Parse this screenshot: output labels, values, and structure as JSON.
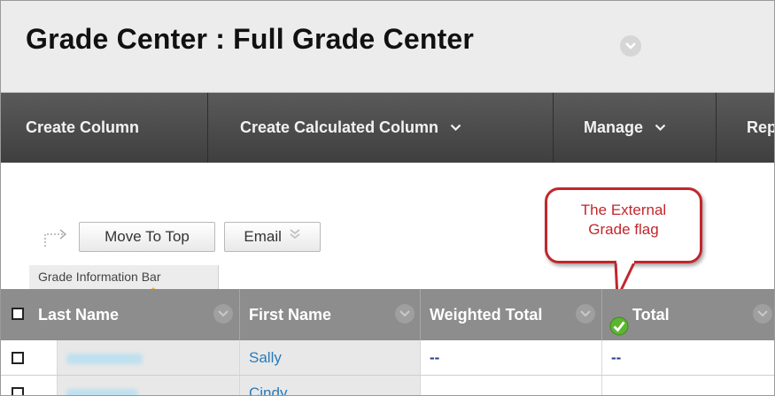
{
  "page": {
    "title": "Grade Center : Full Grade Center"
  },
  "toolbar": {
    "create_column": "Create Column",
    "create_calculated_column": "Create Calculated Column",
    "manage": "Manage",
    "reports_partial": "Rep"
  },
  "actions": {
    "move_to_top": "Move To Top",
    "email": "Email"
  },
  "info_bar": {
    "label": "Grade Information Bar"
  },
  "callout": {
    "line1": "The External",
    "line2": "Grade flag"
  },
  "grid": {
    "columns": [
      "Last Name",
      "First Name",
      "Weighted Total",
      "Total"
    ],
    "rows": [
      {
        "last_name": "",
        "first_name": "Sally",
        "weighted_total": "--",
        "total": "--"
      },
      {
        "last_name": "",
        "first_name": "Cindy",
        "weighted_total": "",
        "total": ""
      }
    ]
  },
  "colors": {
    "toolbar_bg": "#4a4a4a",
    "header_bg": "#8d8d8d",
    "callout_red": "#c0272d",
    "link_blue": "#2a7ab8",
    "flag_green": "#5cb531"
  },
  "icons": [
    "chevron-down-icon",
    "external-grade-flag-icon",
    "checkbox-icon",
    "column-menu-icon",
    "move-arrow-icon"
  ]
}
